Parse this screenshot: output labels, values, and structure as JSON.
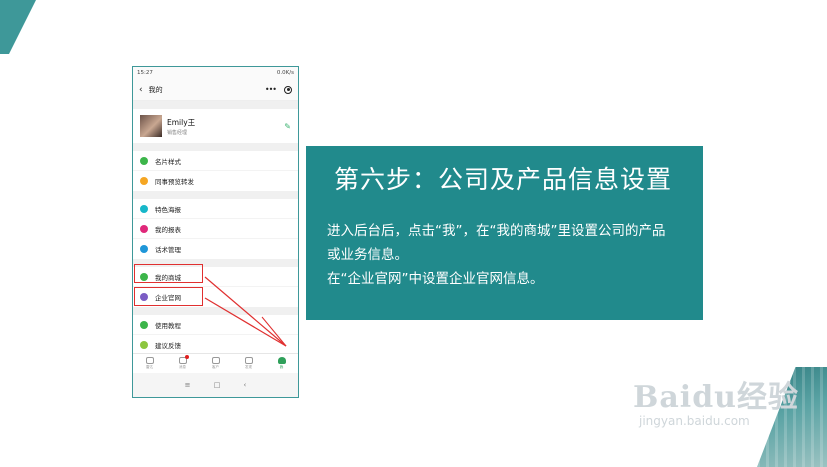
{
  "phone": {
    "status_time": "15:27",
    "status_right": "0.0K/s",
    "nav_title": "我的",
    "nav_more": "•••",
    "profile": {
      "name": "Emily王",
      "role": "销售经理"
    },
    "groups": [
      [
        {
          "label": "名片样式",
          "color": "#3cb54a"
        },
        {
          "label": "同事预览转发",
          "color": "#f5a623"
        }
      ],
      [
        {
          "label": "特色海报",
          "color": "#17b7c9"
        },
        {
          "label": "我的报表",
          "color": "#e0287a"
        },
        {
          "label": "话术管理",
          "color": "#1f96d8"
        }
      ],
      [
        {
          "label": "我的商城",
          "color": "#3cb54a"
        },
        {
          "label": "企业官网",
          "color": "#7b5cc4"
        }
      ],
      [
        {
          "label": "使用教程",
          "color": "#3cb54a"
        },
        {
          "label": "建议反馈",
          "color": "#8cc63f"
        }
      ]
    ],
    "tabs": [
      {
        "label": "雷达",
        "active": false
      },
      {
        "label": "消息",
        "active": false,
        "badge": true
      },
      {
        "label": "客户",
        "active": false
      },
      {
        "label": "发现",
        "active": false
      },
      {
        "label": "我",
        "active": true
      }
    ],
    "android_keys": [
      "≡",
      "□",
      "‹"
    ]
  },
  "panel": {
    "title": "第六步：公司及产品信息设置",
    "lines": [
      "进入后台后，点击“我”，在“我的商城”里设置公司的产品",
      "或业务信息。",
      "在“企业官网”中设置企业官网信息。"
    ]
  },
  "watermark": {
    "main": "Baidu经验",
    "sub": "jingyan.baidu.com"
  },
  "colors": {
    "panel": "#218a8c",
    "accent": "#3e9899",
    "highlight": "#e03030"
  }
}
